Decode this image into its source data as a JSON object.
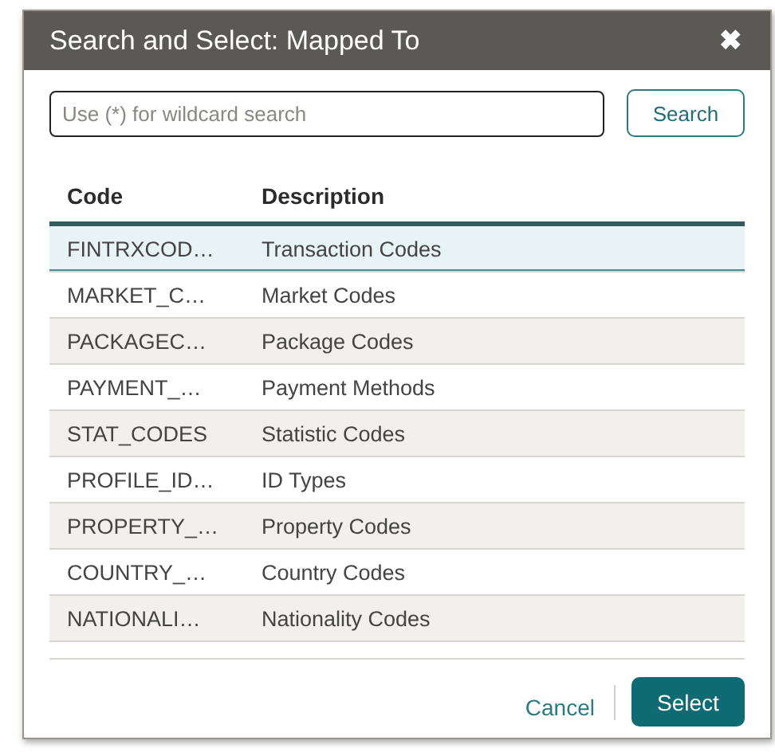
{
  "window": {
    "title": "Search and Select: Mapped To",
    "close": "✖"
  },
  "search": {
    "placeholder": "Use (*) for wildcard search",
    "button": "Search"
  },
  "table": {
    "columns": [
      "Code",
      "Description"
    ],
    "rows": [
      {
        "code": "FINTRXCOD…",
        "description": "Transaction Codes",
        "selected": true
      },
      {
        "code": "MARKET_C…",
        "description": "Market Codes",
        "selected": false
      },
      {
        "code": "PACKAGEC…",
        "description": "Package Codes",
        "selected": false
      },
      {
        "code": "PAYMENT_…",
        "description": "Payment Methods",
        "selected": false
      },
      {
        "code": "STAT_CODES",
        "description": "Statistic Codes",
        "selected": false
      },
      {
        "code": "PROFILE_ID…",
        "description": "ID Types",
        "selected": false
      },
      {
        "code": "PROPERTY_…",
        "description": "Property Codes",
        "selected": false
      },
      {
        "code": "COUNTRY_…",
        "description": "Country Codes",
        "selected": false
      },
      {
        "code": "NATIONALI…",
        "description": "Nationality Codes",
        "selected": false
      }
    ]
  },
  "buttons": {
    "cancel": "Cancel",
    "select": "Select"
  }
}
